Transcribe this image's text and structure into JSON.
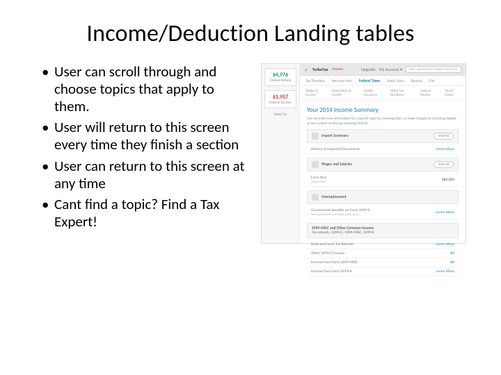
{
  "title": "Income/Deduction Landing tables",
  "bullets": [
    "User can scroll through and choose topics that apply to them.",
    "User will return to this screen every time they finish a section",
    "User can return to this screen at any time",
    "Cant find a topic? Find a Tax Expert!"
  ],
  "screenshot": {
    "logo": "TurboTax",
    "logo_tier": "Premier",
    "upgrade": "Upgrade",
    "account": "My Account ▾",
    "search_placeholder": "Ask a question or search TurboTax",
    "tabs": [
      "Tax Timeline",
      "Personal Info",
      "Federal Taxes",
      "State Taxes",
      "Review",
      "File"
    ],
    "tabs_active": "Federal Taxes",
    "subtabs": [
      "Wages & Income",
      "Deductions & Credits",
      "Health Insurance",
      "Other Tax Situations",
      "Federal Review",
      "Smart Check"
    ],
    "side_amount_1": "$4,976",
    "side_label_1": "Federal Refund",
    "side_amount_2": "$1,957",
    "side_label_2": "Federal Tax Due",
    "side_label_3": "State Tax",
    "heading": "Your 2014 Income Summary",
    "desc1": "You can enter new information for a specific topic by choosing Start, or make changes by choosing Update, or see a whole section by choosing Visit All.",
    "section1": {
      "title": "Import Summary",
      "row1": "History of Imported Documents",
      "learn": "Learn More"
    },
    "section2": {
      "title": "Wages and Salaries",
      "row1": "Form W-2",
      "visit": "Visit All",
      "learn": "Learn More",
      "amount": "$80,000"
    },
    "section3": {
      "title": "Unemployment",
      "row1": "Government benefits on Form 1099-G",
      "row2": "Unemployment and Paid Family Leave",
      "learn": "Learn More"
    },
    "section4": {
      "title": "1099-MISC and Other Common Income",
      "sub": "Tax refunds, 1099-G, 1099-MISC, 1099-K",
      "row1": "State and Local Tax Refunds",
      "row2": "Other 1099-G Income",
      "row3": "Income from Form 1099-MISC",
      "row4": "Income from Form 1099-K",
      "learn": "Learn More",
      "amt1": "$0",
      "amt2": "$0"
    }
  }
}
